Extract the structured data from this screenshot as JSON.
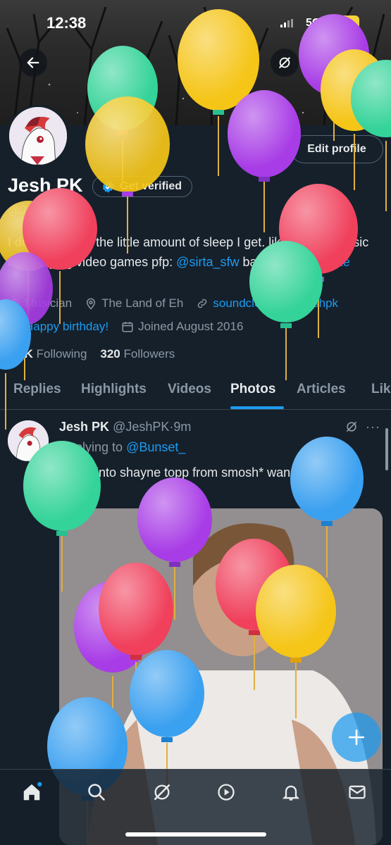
{
  "status_bar": {
    "time": "12:38",
    "network": "5G+",
    "battery": "77"
  },
  "profile": {
    "name": "Jesh PK",
    "verify_label": "Get verified",
    "handle": "@JeshPK",
    "edit_label": "Edit profile",
    "bio_part1": "I do things with the little amount of sleep I get. like making music and playing video games pfp: ",
    "bio_link1": "@sirta_sfw",
    "bio_part2": " banner: ",
    "bio_link2": "@arayalite",
    "profession": "Musician",
    "location": "The Land of Eh",
    "website": "soundcloud.com/jeshpk",
    "birthday": "Happy birthday!",
    "joined": "Joined August 2016",
    "following_count": "1.2K",
    "following_label": "Following",
    "followers_count": "320",
    "followers_label": "Followers"
  },
  "tabs": [
    "Replies",
    "Highlights",
    "Videos",
    "Photos",
    "Articles",
    "Lik"
  ],
  "active_tab": "Photos",
  "post": {
    "name": "Jesh PK",
    "handle": "@JeshPK",
    "dot": "·",
    "time": "9m",
    "more": "···",
    "replying_label": "Replying to",
    "replying_to": "@Bunset_",
    "text": "*turns into shayne topp from smosh* wanna say that again"
  },
  "fab_label": "+",
  "colors": {
    "background": "#15202b",
    "accent": "#1d9bf0",
    "muted": "#8b98a5",
    "text": "#e7e9ea",
    "balloon_green": "#34d399",
    "balloon_yellow": "#f5c518",
    "balloon_purple": "#a83ce6",
    "balloon_red": "#f0405c",
    "balloon_blue": "#3aa0f0"
  },
  "icons": [
    "back-arrow-icon",
    "grok-icon",
    "search-icon",
    "verified-check-icon",
    "briefcase-icon",
    "location-pin-icon",
    "link-icon",
    "balloon-icon",
    "calendar-icon",
    "home-icon",
    "grok-nav-icon",
    "play-circle-icon",
    "bell-icon",
    "mail-icon",
    "plus-icon"
  ]
}
